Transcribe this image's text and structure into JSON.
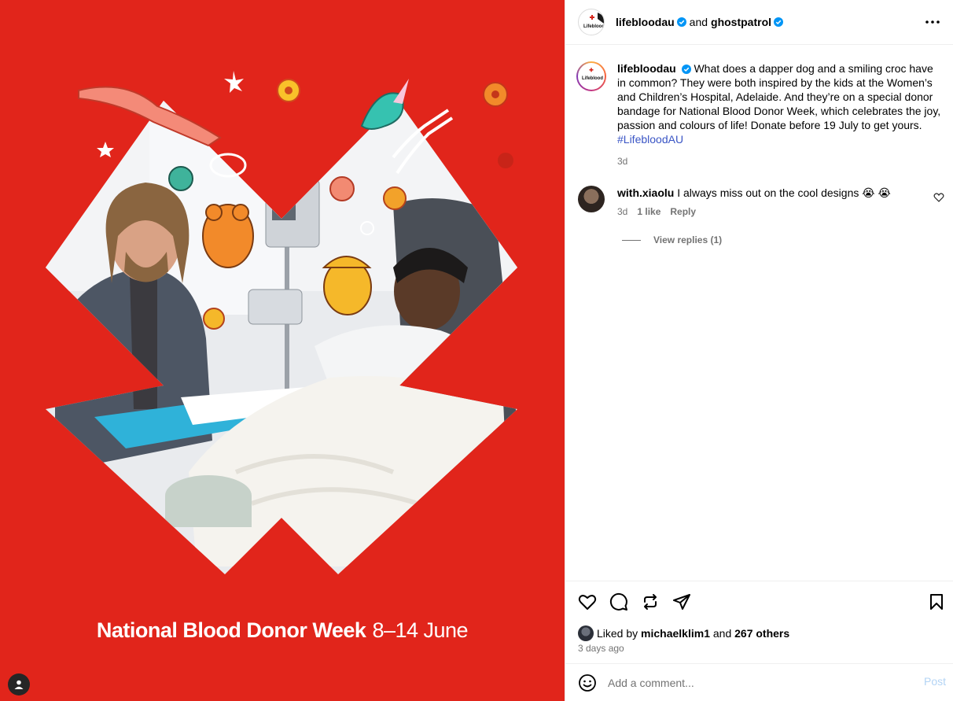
{
  "media": {
    "caption_title": "National Blood Donor Week",
    "caption_dates": "8–14 June",
    "background_color": "#e1251b",
    "shape": "cross-shaped photo frame with doodles"
  },
  "header": {
    "account1": "lifebloodau",
    "conjunction": "and",
    "account2": "ghostpatrol",
    "avatar_logo_text": "Lifeblood"
  },
  "caption": {
    "username": "lifebloodau",
    "text": "What does a dapper dog and a smiling croc have in common? They were both inspired by the kids at the Women’s and Children’s Hospital, Adelaide. And they’re on a special donor bandage for National Blood Donor Week, which celebrates the joy, passion and colours of life! Donate before 19 July to get yours.",
    "hashtag": "#LifebloodAU",
    "time": "3d"
  },
  "comment": {
    "username": "with.xiaolu",
    "text": "I always miss out on the cool designs",
    "emojis": "😭 😭",
    "time": "3d",
    "likes": "1 like",
    "reply": "Reply",
    "view_replies": "View replies (1)"
  },
  "likes": {
    "prefix": "Liked by",
    "user": "michaelklim1",
    "and": "and",
    "others": "267 others",
    "timestamp": "3 days ago"
  },
  "add_comment": {
    "placeholder": "Add a comment...",
    "post": "Post"
  },
  "colors": {
    "verified": "#0095f6",
    "link": "#3a55c5",
    "muted": "#737373"
  }
}
